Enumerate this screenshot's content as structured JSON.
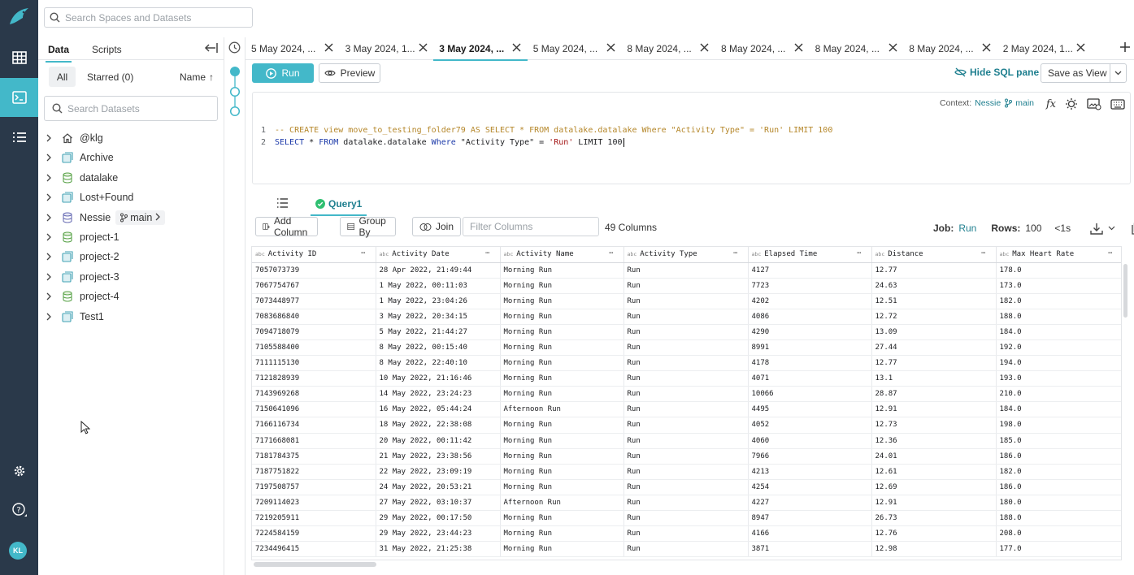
{
  "rail": {
    "items": [
      "home-logo",
      "datasets",
      "sql-runner",
      "jobs"
    ],
    "avatar_initials": "KL"
  },
  "search": {
    "placeholder": "Search Spaces and Datasets"
  },
  "sidebar": {
    "tabs": [
      "Data",
      "Scripts"
    ],
    "filters": {
      "all": "All",
      "starred": "Starred (0)",
      "sort": "Name"
    },
    "dataset_search_placeholder": "Search Datasets",
    "tree": [
      {
        "label": "@klg",
        "icon": "home-icon"
      },
      {
        "label": "Archive",
        "icon": "space-icon"
      },
      {
        "label": "datalake",
        "icon": "source-icon"
      },
      {
        "label": "Lost+Found",
        "icon": "space-icon"
      },
      {
        "label": "Nessie",
        "icon": "nessie-icon",
        "branch": "main"
      },
      {
        "label": "project-1",
        "icon": "source-icon"
      },
      {
        "label": "project-2",
        "icon": "space-icon"
      },
      {
        "label": "project-3",
        "icon": "space-icon"
      },
      {
        "label": "project-4",
        "icon": "source-icon"
      },
      {
        "label": "Test1",
        "icon": "space-icon"
      }
    ]
  },
  "tabs": [
    {
      "label": "5 May 2024, ...",
      "active": false
    },
    {
      "label": "3 May 2024, 1...",
      "active": false
    },
    {
      "label": "3 May 2024, ...",
      "active": true
    },
    {
      "label": "5 May 2024, ...",
      "active": false
    },
    {
      "label": "8 May 2024, ...",
      "active": false
    },
    {
      "label": "8 May 2024, ...",
      "active": false
    },
    {
      "label": "8 May 2024, ...",
      "active": false
    },
    {
      "label": "8 May 2024, ...",
      "active": false
    },
    {
      "label": "2 May 2024, 1...",
      "active": false
    }
  ],
  "actions": {
    "run": "Run",
    "preview": "Preview",
    "hide_sql": "Hide SQL pane",
    "save_as_view": "Save as View"
  },
  "editor": {
    "context_label": "Context:",
    "context_source": "Nessie",
    "context_branch": "main",
    "line1": {
      "num": "1",
      "text": "-- CREATE view move_to_testing_folder79 AS SELECT * FROM datalake.datalake Where \"Activity Type\" = 'Run' LIMIT 100"
    },
    "line2": {
      "num": "2",
      "kw_select": "SELECT",
      "star": " * ",
      "kw_from": "FROM",
      "table": " datalake.datalake ",
      "kw_where": "Where",
      "cond": " \"Activity Type\" = ",
      "str": "'Run'",
      "limit": " LIMIT 100"
    }
  },
  "results": {
    "tab_label": "Query1",
    "toolbar": {
      "add_column": "Add Column",
      "group_by": "Group By",
      "join": "Join",
      "filter_placeholder": "Filter Columns",
      "column_count": "49 Columns"
    },
    "job_label": "Job:",
    "job_value": "Run",
    "rows_label": "Rows:",
    "rows_value": "100",
    "time": "<1s",
    "columns": [
      "Activity ID",
      "Activity Date",
      "Activity Name",
      "Activity Type",
      "Elapsed Time",
      "Distance",
      "Max Heart Rate"
    ],
    "rows": [
      [
        "7057073739",
        "28 Apr 2022, 21:49:44",
        "Morning Run",
        "Run",
        "4127",
        "12.77",
        "178.0"
      ],
      [
        "7067754767",
        "1 May 2022, 00:11:03",
        "Morning Run",
        "Run",
        "7723",
        "24.63",
        "173.0"
      ],
      [
        "7073448977",
        "1 May 2022, 23:04:26",
        "Morning Run",
        "Run",
        "4202",
        "12.51",
        "182.0"
      ],
      [
        "7083686840",
        "3 May 2022, 20:34:15",
        "Morning Run",
        "Run",
        "4086",
        "12.72",
        "188.0"
      ],
      [
        "7094718079",
        "5 May 2022, 21:44:27",
        "Morning Run",
        "Run",
        "4290",
        "13.09",
        "184.0"
      ],
      [
        "7105588400",
        "8 May 2022, 00:15:40",
        "Morning Run",
        "Run",
        "8991",
        "27.44",
        "192.0"
      ],
      [
        "7111115130",
        "8 May 2022, 22:40:10",
        "Morning Run",
        "Run",
        "4178",
        "12.77",
        "194.0"
      ],
      [
        "7121828939",
        "10 May 2022, 21:16:46",
        "Morning Run",
        "Run",
        "4071",
        "13.1",
        "193.0"
      ],
      [
        "7143969268",
        "14 May 2022, 23:24:23",
        "Morning Run",
        "Run",
        "10066",
        "28.87",
        "210.0"
      ],
      [
        "7150641096",
        "16 May 2022, 05:44:24",
        "Afternoon Run",
        "Run",
        "4495",
        "12.91",
        "184.0"
      ],
      [
        "7166116734",
        "18 May 2022, 22:38:08",
        "Morning Run",
        "Run",
        "4052",
        "12.73",
        "198.0"
      ],
      [
        "7171668081",
        "20 May 2022, 00:11:42",
        "Morning Run",
        "Run",
        "4060",
        "12.36",
        "185.0"
      ],
      [
        "7181784375",
        "21 May 2022, 23:38:56",
        "Morning Run",
        "Run",
        "7966",
        "24.01",
        "186.0"
      ],
      [
        "7187751822",
        "22 May 2022, 23:09:19",
        "Morning Run",
        "Run",
        "4213",
        "12.61",
        "182.0"
      ],
      [
        "7197508757",
        "24 May 2022, 20:53:21",
        "Morning Run",
        "Run",
        "4254",
        "12.69",
        "186.0"
      ],
      [
        "7209114023",
        "27 May 2022, 03:10:37",
        "Afternoon Run",
        "Run",
        "4227",
        "12.91",
        "180.0"
      ],
      [
        "7219205911",
        "29 May 2022, 00:17:50",
        "Morning Run",
        "Run",
        "8947",
        "26.73",
        "188.0"
      ],
      [
        "7224584159",
        "29 May 2022, 23:44:23",
        "Morning Run",
        "Run",
        "4166",
        "12.76",
        "208.0"
      ],
      [
        "7234496415",
        "31 May 2022, 21:25:38",
        "Morning Run",
        "Run",
        "3871",
        "12.98",
        "177.0"
      ]
    ]
  }
}
